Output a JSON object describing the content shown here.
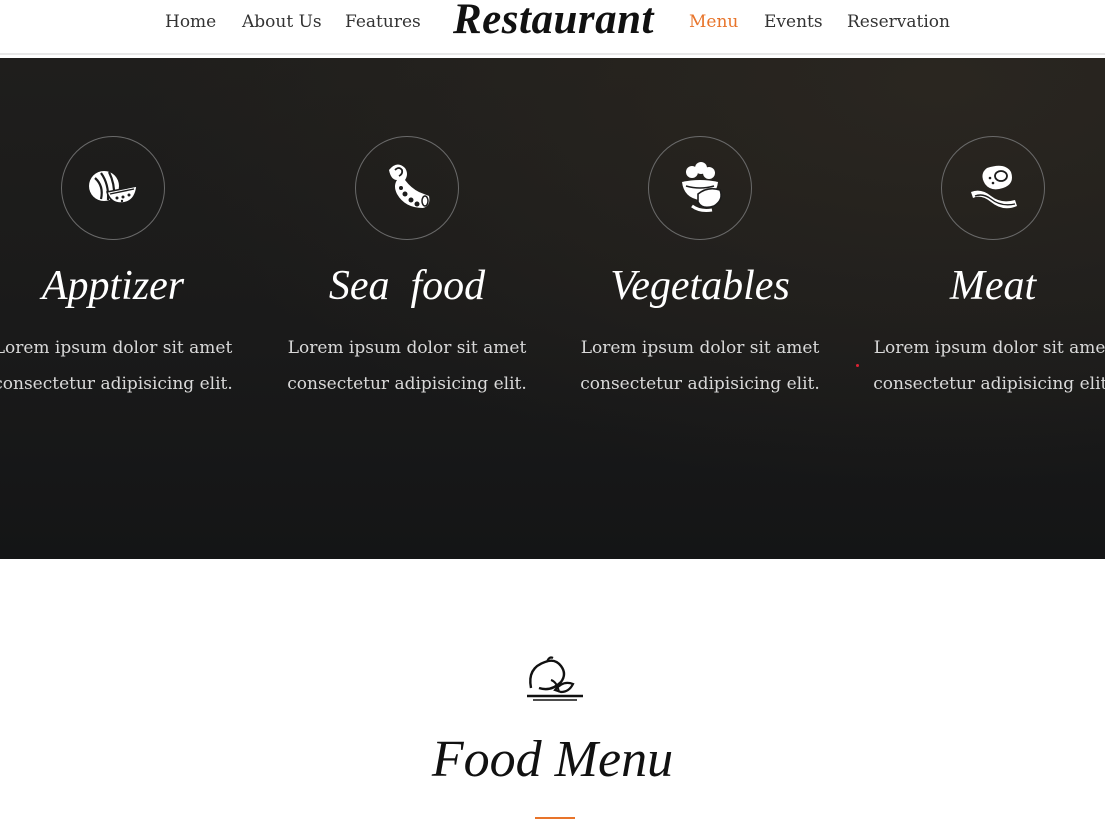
{
  "nav": {
    "left_items": [
      "Home",
      "About Us",
      "Features"
    ],
    "brand": "Restaurant",
    "right_items": [
      "Menu",
      "Events",
      "Reservation"
    ],
    "active": "Menu",
    "active_color": "#e8742a"
  },
  "categories": [
    {
      "title": "Apptizer",
      "icon": "watermelon-icon",
      "line1": "Lorem ipsum dolor sit amet",
      "line2": "consectetur adipisicing elit."
    },
    {
      "title": "Sea  food",
      "icon": "octopus-tentacle-icon",
      "line1": "Lorem ipsum dolor sit amet",
      "line2": "consectetur adipisicing elit."
    },
    {
      "title": "Vegetables",
      "icon": "vegetable-basket-icon",
      "line1": "Lorem ipsum dolor sit amet",
      "line2": "consectetur adipisicing elit."
    },
    {
      "title": "Meat",
      "icon": "egg-bacon-icon",
      "line1": "Lorem ipsum dolor sit amet",
      "line2": "consectetur adipisicing elit."
    }
  ],
  "food_menu": {
    "heading": "Food Menu",
    "icon": "cloche-icon",
    "accent_color": "#e8742a"
  }
}
